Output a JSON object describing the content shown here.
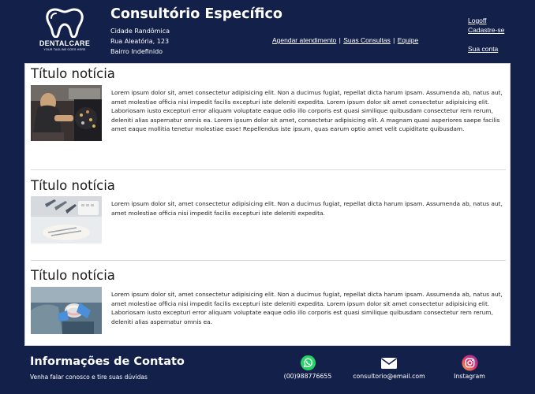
{
  "brand": {
    "name": "DENTALCARE",
    "tagline": "YOUR TAGLINE GOES HERE"
  },
  "clinic": {
    "title": "Consultório Específico",
    "address": [
      "Cidade Randômica",
      "Rua Aleatória, 123",
      "Bairro Indefinido"
    ]
  },
  "nav": {
    "schedule": "Agendar atendimento",
    "consults": "Suas Consultas",
    "team": "Equipe",
    "separator": "|"
  },
  "user_nav": {
    "logoff": "Logoff",
    "signup": "Cadastre-se",
    "account": "Sua conta"
  },
  "news": [
    {
      "title": "Título notícia",
      "image_icon": "dentist-at-work-photo",
      "text": "Lorem ipsum dolor sit, amet consectetur adipisicing elit. Non a ducimus fugiat, repellat dicta harum ipsam. Assumenda ab, natus aut, amet molestiae officia nisi impedit facilis excepturi iste deleniti expedita. Lorem ipsum dolor sit amet consectetur adipisicing elit. Laboriosam iusto excepturi error aliquam voluptate eaque odio illo corporis est quasi similique quibusdam consectetur rem rerum, deleniti alias aspernatur omnis ea. Lorem ipsum dolor sit amet, consectetur adipisicing elit. A magnam quasi asperiores saepe facilis amet eaque mollitia tenetur molestiae esse! Repellendus iste ipsum, quas earum optio amet velit cupiditate quibusdam."
    },
    {
      "title": "Título notícia",
      "image_icon": "dental-instruments-photo",
      "text": "Lorem ipsum dolor sit, amet consectetur adipisicing elit. Non a ducimus fugiat, repellat dicta harum ipsam. Assumenda ab, natus aut, amet molestiae officia nisi impedit facilis excepturi iste deleniti expedita."
    },
    {
      "title": "Título notícia",
      "image_icon": "dental-model-photo",
      "text": "Lorem ipsum dolor sit, amet consectetur adipisicing elit. Non a ducimus fugiat, repellat dicta harum ipsam. Assumenda ab, natus aut, amet molestiae officia nisi impedit facilis excepturi iste deleniti expedita. Lorem ipsum dolor sit amet consectetur adipisicing elit. Laboriosam iusto excepturi error aliquam voluptate eaque odio illo corporis est quasi similique quibusdam consectetur rem rerum, deleniti alias aspernatur omnis ea."
    }
  ],
  "footer": {
    "title": "Informações de Contato",
    "subtitle": "Venha falar conosco e tire suas dúvidas",
    "contacts": [
      {
        "icon": "whatsapp-icon",
        "label": "(00)988776655",
        "color": "#25d366"
      },
      {
        "icon": "email-icon",
        "label": "consultorio@email.com",
        "color": "#ffffff"
      },
      {
        "icon": "instagram-icon",
        "label": "Instagram",
        "color": "#e1306c"
      }
    ]
  },
  "colors": {
    "background": "#13204a",
    "content": "#ffffff"
  }
}
